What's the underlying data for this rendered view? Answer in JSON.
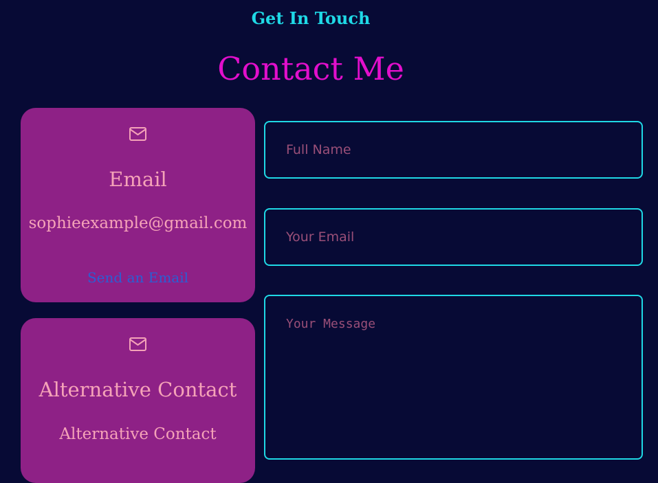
{
  "header": {
    "eyebrow": "Get In Touch",
    "title": "Contact Me"
  },
  "cards": {
    "email": {
      "icon": "mail-icon",
      "title": "Email",
      "value": "sophieexample@gmail.com",
      "link": "Send an Email"
    },
    "alternative": {
      "icon": "mail-icon",
      "title": "Alternative Contact",
      "value": "Alternative Contact"
    }
  },
  "form": {
    "name_placeholder": "Full Name",
    "email_placeholder": "Your Email",
    "message_placeholder": "Your Message",
    "name_value": "",
    "email_value": "",
    "message_value": ""
  },
  "colors": {
    "background": "#070a35",
    "accent_cyan": "#1fd9e6",
    "accent_magenta": "#e20fcc",
    "card_bg": "#8e2186",
    "card_text": "#f5a3b8",
    "link_blue": "#2a5fd4",
    "placeholder": "#9a4f78"
  }
}
